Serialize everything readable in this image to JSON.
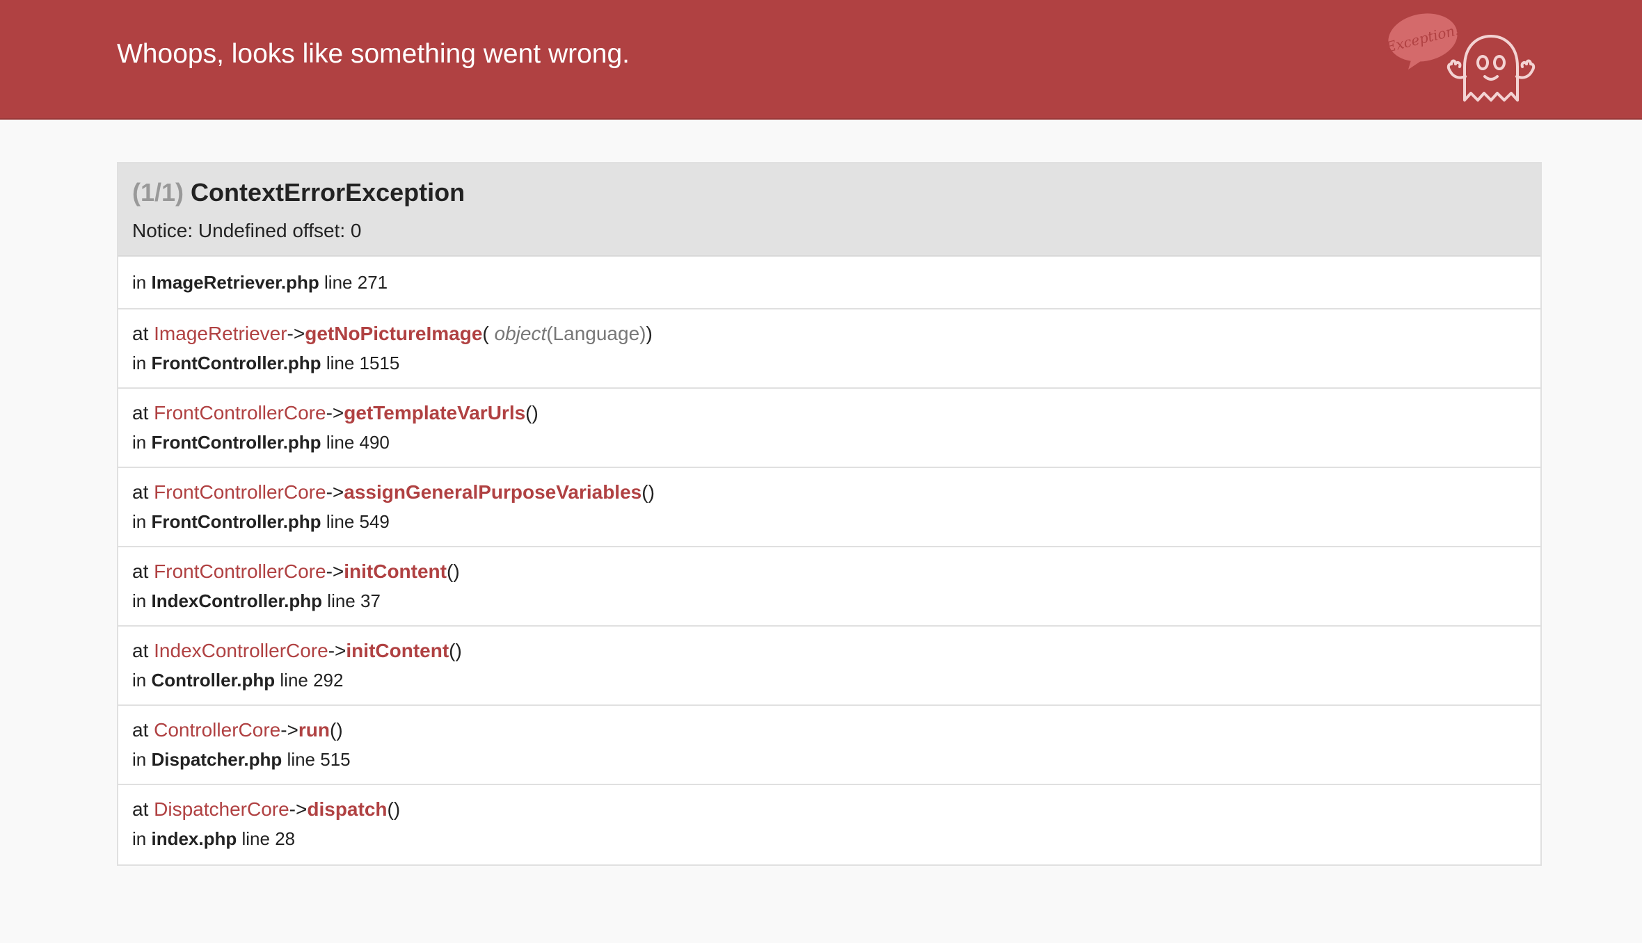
{
  "header": {
    "title": "Whoops, looks like something went wrong.",
    "logo_bubble_text": "Exception!"
  },
  "exception": {
    "count": "(1/1)",
    "name": "ContextErrorException",
    "message": "Notice: Undefined offset: 0"
  },
  "first_frame": {
    "prefix": "in",
    "file": "ImageRetriever.php",
    "line_label": "line 271"
  },
  "frames": [
    {
      "at": "at",
      "class": "ImageRetriever",
      "arrow": "->",
      "method": "getNoPictureImage",
      "paren_open": "(",
      "arg_type": "object",
      "arg_value": "(Language)",
      "paren_close": ")",
      "in": "in",
      "file": "FrontController.php",
      "line_label": "line 1515"
    },
    {
      "at": "at",
      "class": "FrontControllerCore",
      "arrow": "->",
      "method": "getTemplateVarUrls",
      "paren_open": "(",
      "arg_type": "",
      "arg_value": "",
      "paren_close": ")",
      "in": "in",
      "file": "FrontController.php",
      "line_label": "line 490"
    },
    {
      "at": "at",
      "class": "FrontControllerCore",
      "arrow": "->",
      "method": "assignGeneralPurposeVariables",
      "paren_open": "(",
      "arg_type": "",
      "arg_value": "",
      "paren_close": ")",
      "in": "in",
      "file": "FrontController.php",
      "line_label": "line 549"
    },
    {
      "at": "at",
      "class": "FrontControllerCore",
      "arrow": "->",
      "method": "initContent",
      "paren_open": "(",
      "arg_type": "",
      "arg_value": "",
      "paren_close": ")",
      "in": "in",
      "file": "IndexController.php",
      "line_label": "line 37"
    },
    {
      "at": "at",
      "class": "IndexControllerCore",
      "arrow": "->",
      "method": "initContent",
      "paren_open": "(",
      "arg_type": "",
      "arg_value": "",
      "paren_close": ")",
      "in": "in",
      "file": "Controller.php",
      "line_label": "line 292"
    },
    {
      "at": "at",
      "class": "ControllerCore",
      "arrow": "->",
      "method": "run",
      "paren_open": "(",
      "arg_type": "",
      "arg_value": "",
      "paren_close": ")",
      "in": "in",
      "file": "Dispatcher.php",
      "line_label": "line 515"
    },
    {
      "at": "at",
      "class": "DispatcherCore",
      "arrow": "->",
      "method": "dispatch",
      "paren_open": "(",
      "arg_type": "",
      "arg_value": "",
      "paren_close": ")",
      "in": "in",
      "file": "index.php",
      "line_label": "line 28"
    }
  ],
  "colors": {
    "header_bg": "#b04142",
    "accent": "#b04142",
    "page_bg": "#f9f9f9",
    "panel_head_bg": "#e2e2e2"
  }
}
